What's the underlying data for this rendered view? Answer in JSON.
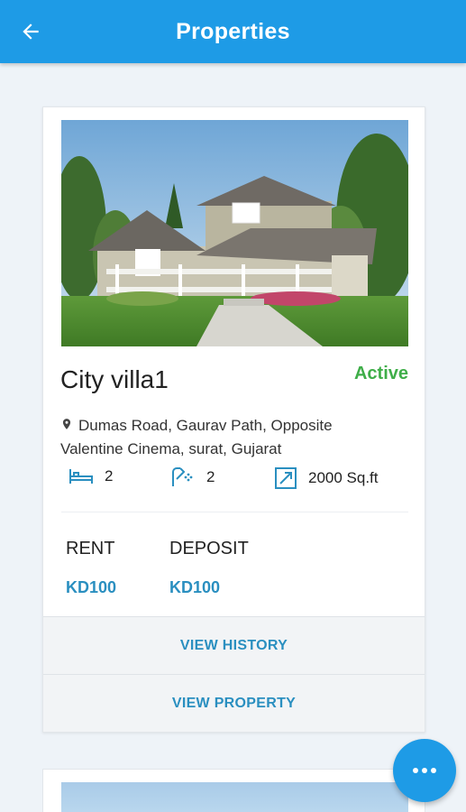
{
  "appbar": {
    "title": "Properties",
    "back_icon": "arrow-left-icon"
  },
  "property": {
    "name": "City villa1",
    "status": "Active",
    "address": "Dumas Road, Gaurav Path, Opposite Valentine Cinema, surat, Gujarat",
    "features": {
      "bedrooms": "2",
      "bathrooms": "2",
      "area": "2000 Sq.ft"
    },
    "rent_label": "RENT",
    "rent_value": "KD100",
    "deposit_label": "DEPOSIT",
    "deposit_value": "KD100",
    "view_history_label": "VIEW HISTORY",
    "view_property_label": "VIEW PROPERTY"
  },
  "colors": {
    "primary": "#1e9be6",
    "status_active": "#3fae49",
    "link": "#2a8fc0"
  },
  "fab_icon": "more-dots-icon"
}
